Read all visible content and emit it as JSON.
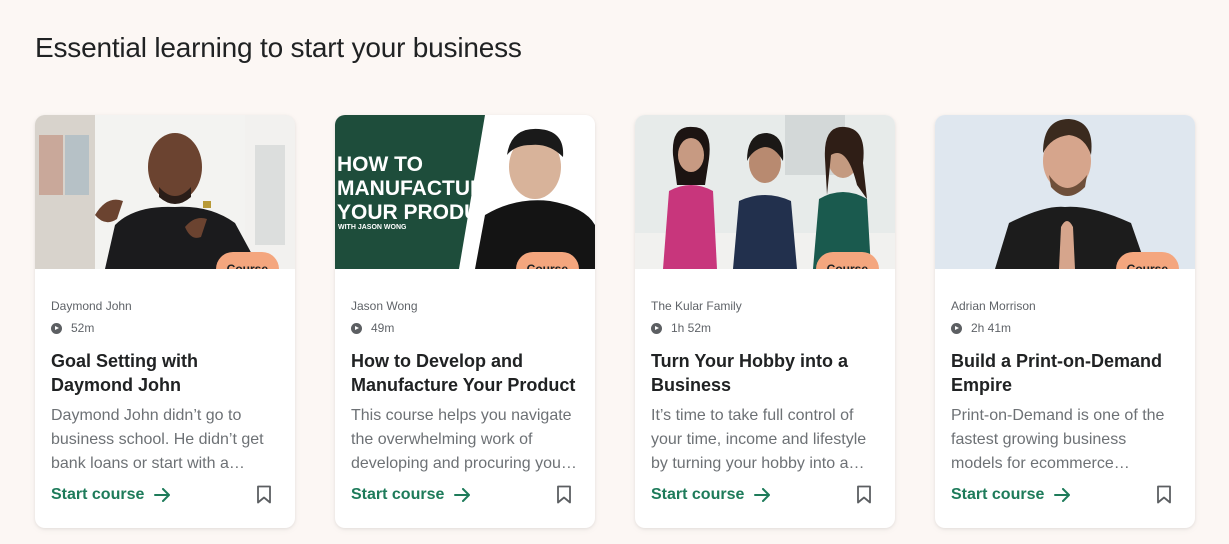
{
  "section": {
    "title": "Essential learning to start your business"
  },
  "colors": {
    "background": "#fcf7f4",
    "badge": "#f4a67e",
    "link": "#1e7b5a"
  },
  "cards": [
    {
      "badge": "Course",
      "author": "Daymond John",
      "duration": "52m",
      "title": "Goal Setting with Daymond John",
      "description": "Daymond John didn’t go to business school. He didn’t get bank loans or start with a…",
      "cta": "Start course"
    },
    {
      "badge": "Course",
      "author": "Jason Wong",
      "duration": "49m",
      "title": "How to Develop and Manufacture Your Product",
      "description": "This course helps you navigate the overwhelming work of developing and procuring you…",
      "cta": "Start course",
      "thumb_text": [
        "HOW TO",
        "MANUFACTURE",
        "YOUR PRODUCT",
        "WITH JASON WONG"
      ]
    },
    {
      "badge": "Course",
      "author": "The Kular Family",
      "duration": "1h 52m",
      "title": "Turn Your Hobby into a Business",
      "description": "It’s time to take full control of your time, income and lifestyle by turning your hobby into a…",
      "cta": "Start course"
    },
    {
      "badge": "Course",
      "author": "Adrian Morrison",
      "duration": "2h 41m",
      "title": "Build a Print-on-Demand Empire",
      "description": "Print-on-Demand is one of the fastest growing business models for ecommerce…",
      "cta": "Start course"
    }
  ]
}
